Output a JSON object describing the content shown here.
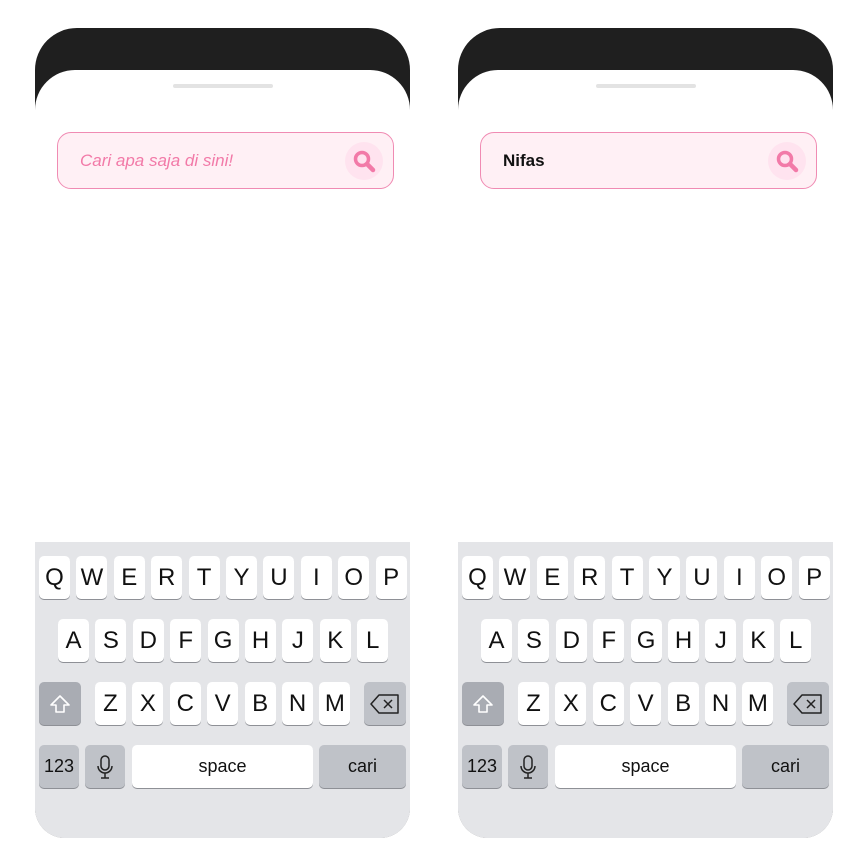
{
  "screens": [
    {
      "search": {
        "text": "Cari apa saja di sini!",
        "is_placeholder": true
      }
    },
    {
      "search": {
        "text": "Nifas",
        "is_placeholder": false
      }
    }
  ],
  "keyboard": {
    "row1": [
      "Q",
      "W",
      "E",
      "R",
      "T",
      "Y",
      "U",
      "I",
      "O",
      "P"
    ],
    "row2": [
      "A",
      "S",
      "D",
      "F",
      "G",
      "H",
      "J",
      "K",
      "L"
    ],
    "row3": [
      "Z",
      "X",
      "C",
      "V",
      "B",
      "N",
      "M"
    ],
    "numbers_label": "123",
    "space_label": "space",
    "action_label": "cari"
  },
  "colors": {
    "accent": "#f27aa8",
    "search_border": "#f08bb3",
    "search_bg": "#fff0f5",
    "keyboard_bg": "#e4e5e8"
  },
  "icons": [
    "search-icon",
    "shift-icon",
    "microphone-icon",
    "backspace-icon"
  ]
}
